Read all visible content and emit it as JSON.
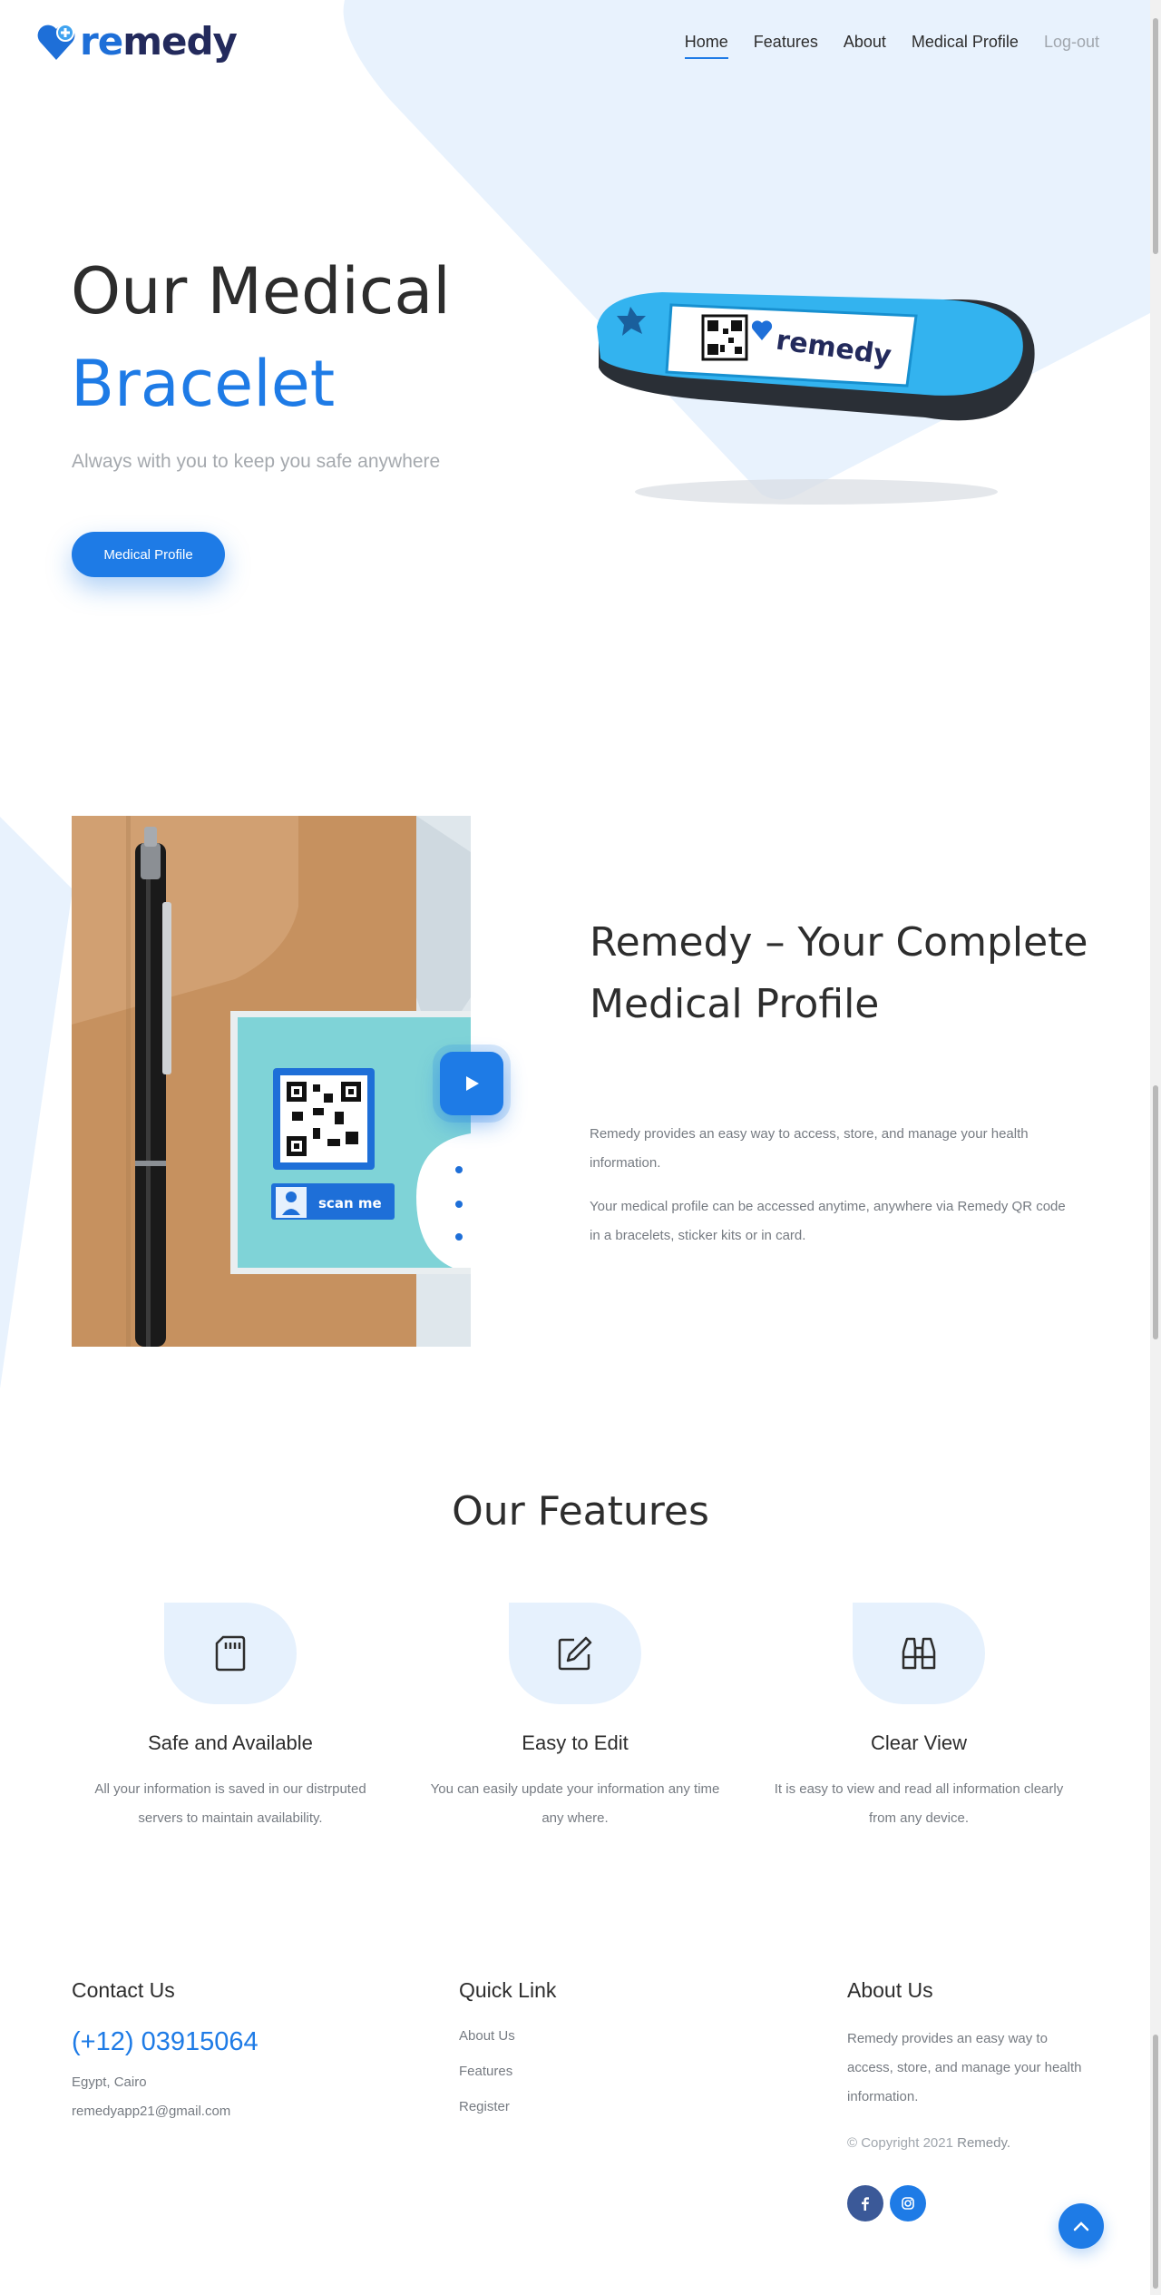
{
  "brand": {
    "logo_text_a": "re",
    "logo_text_b": "medy"
  },
  "nav": {
    "items": [
      {
        "label": "Home",
        "active": true
      },
      {
        "label": "Features"
      },
      {
        "label": "About"
      },
      {
        "label": "Medical Profile"
      },
      {
        "label": "Log-out"
      }
    ]
  },
  "hero": {
    "title_line1": "Our Medical",
    "title_line2": "Bracelet",
    "subtitle": "Always with you to keep you safe anywhere",
    "cta_label": "Medical Profile",
    "bracelet_brand": "remedy"
  },
  "about": {
    "card_scan_label": "scan me",
    "title": "Remedy – Your Complete Medical Profile",
    "paragraph1": "Remedy provides an easy way to access, store, and manage your health information.",
    "paragraph2": "Your medical profile can be accessed anytime, anywhere via Remedy QR code in a bracelets, sticker kits or in card."
  },
  "features": {
    "title": "Our Features",
    "items": [
      {
        "icon": "sd-card-icon",
        "title": "Safe and Available",
        "desc": "All your information is saved in our distrputed servers to maintain availability."
      },
      {
        "icon": "edit-icon",
        "title": "Easy to Edit",
        "desc": "You can easily update your information any time any where."
      },
      {
        "icon": "binoculars-icon",
        "title": "Clear View",
        "desc": "It is easy to view and read all information clearly from any device."
      }
    ]
  },
  "footer": {
    "contact": {
      "heading": "Contact Us",
      "phone": "(+12) 03915064",
      "location": "Egypt, Cairo",
      "email": "remedyapp21@gmail.com"
    },
    "quick_link": {
      "heading": "Quick Link",
      "links": [
        "About Us",
        "Features",
        "Register"
      ]
    },
    "about": {
      "heading": "About Us",
      "text": "Remedy provides an easy way to access, store, and manage your health information.",
      "copyright_prefix": "© Copyright 2021",
      "copyright_brand": "Remedy."
    },
    "social": [
      {
        "icon": "facebook-icon",
        "color": "#3b5998"
      },
      {
        "icon": "instagram-icon",
        "color": "#1e7be6"
      }
    ]
  },
  "colors": {
    "accent": "#1e7be6",
    "navy": "#232a5c",
    "soft_blue": "#e6f1fd"
  }
}
